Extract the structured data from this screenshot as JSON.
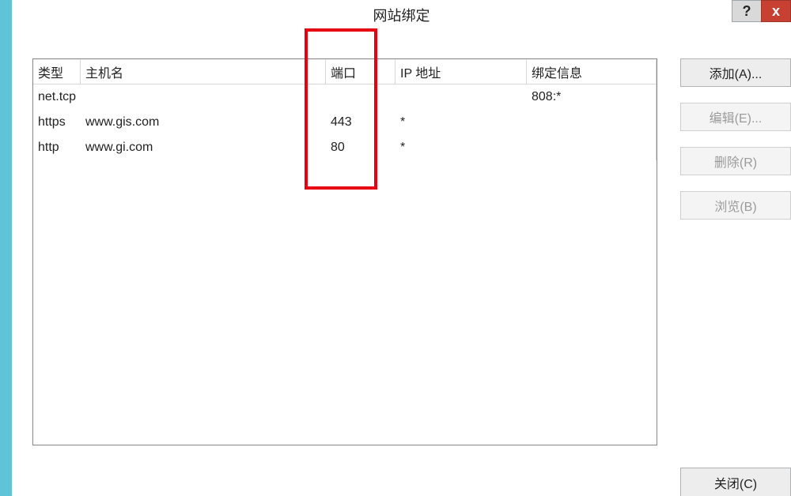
{
  "window": {
    "title": "网站绑定",
    "help_label": "?",
    "close_label": "x"
  },
  "table": {
    "headers": {
      "type": "类型",
      "host": "主机名",
      "port": "端口",
      "ip": "IP 地址",
      "binding": "绑定信息"
    },
    "rows": [
      {
        "type": "net.tcp",
        "host_prefix": "",
        "host_suffix": "",
        "host_censored": false,
        "port": "",
        "ip": "",
        "binding": "808:*"
      },
      {
        "type": "https",
        "host_prefix": "www.gis",
        "host_suffix": ".com",
        "host_censored": true,
        "port": "443",
        "ip": "*",
        "binding": ""
      },
      {
        "type": "http",
        "host_prefix": "www.gi",
        "host_suffix": ".com",
        "host_censored": true,
        "port": "80",
        "ip": "*",
        "binding": ""
      }
    ]
  },
  "buttons": {
    "add": "添加(A)...",
    "edit": "编辑(E)...",
    "delete": "删除(R)",
    "browse": "浏览(B)",
    "close": "关闭(C)"
  }
}
